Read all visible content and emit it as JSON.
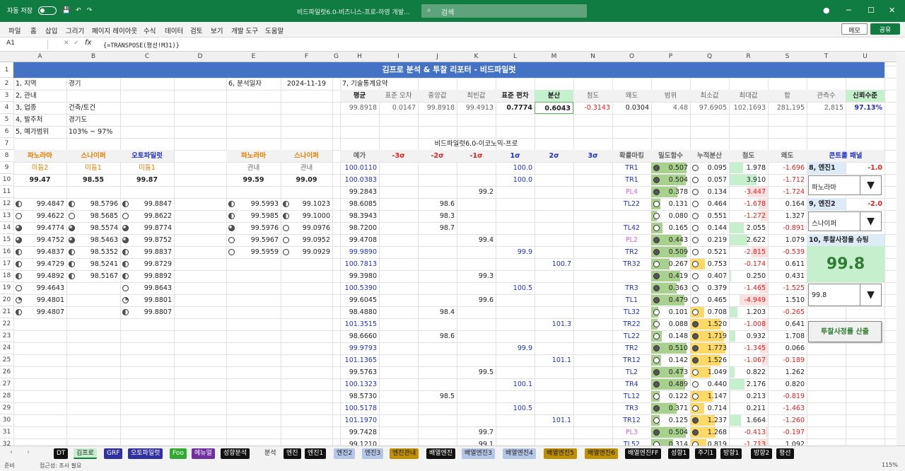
{
  "titlebar": {
    "autosave": "자동 저장",
    "file": "비드파일럿6.0-비즈니스-프로-하영 개발...",
    "search": "검색",
    "min": "─",
    "max": "☐",
    "close": "✕"
  },
  "menu": [
    "파일",
    "홈",
    "삽입",
    "그리기",
    "페이지 레이아웃",
    "수식",
    "데이터",
    "검토",
    "보기",
    "개발 도구",
    "도움말"
  ],
  "memo": "메모",
  "share": "공유",
  "namebox": "A1",
  "formula": "{=TRANSPOSE(평선!M31)}",
  "columns": [
    "A",
    "B",
    "C",
    "D",
    "E",
    "F",
    "G",
    "H",
    "I",
    "J",
    "K",
    "L",
    "M",
    "N",
    "O",
    "P",
    "Q",
    "R",
    "S",
    "T",
    "U"
  ],
  "rows": [
    "1",
    "2",
    "3",
    "4",
    "5",
    "6",
    "7",
    "8",
    "9",
    "10",
    "11",
    "12",
    "13",
    "14",
    "15",
    "16",
    "17",
    "18",
    "19",
    "20",
    "21",
    "22",
    "23",
    "24",
    "25",
    "26",
    "27",
    "28",
    "29",
    "30",
    "31",
    "32",
    "33"
  ],
  "banner": "김프로 분석 & 투찰 리포터 - 비드파일럿",
  "info": {
    "l1": "1, 지역",
    "v1": "경기",
    "l2": "2, 관내",
    "v2": "",
    "l3": "3, 업종",
    "v3": "건축/토건",
    "l4": "4, 발주처",
    "v4": "경기도",
    "l5": "5, 예가범위",
    "v5": "103% ~ 97%",
    "l6": "6, 분석일자",
    "v6": "2024-11-19",
    "l7": "7, 기술통계요약"
  },
  "stats": {
    "headers": [
      "평균",
      "표준 오차",
      "중앙값",
      "최빈값",
      "표준 편차",
      "분산",
      "첨도",
      "왜도",
      "범위",
      "최소값",
      "최대값",
      "합",
      "관측수",
      "신뢰수준"
    ],
    "values": [
      "99.8918",
      "0.0147",
      "99.8918",
      "99.4913",
      "0.7774",
      "0.6043",
      "-0.3143",
      "0.0304",
      "4.48",
      "97.6905",
      "102.1693",
      "281,195",
      "2,815",
      "97.13%"
    ]
  },
  "subtitle": "비드파일럿6.0-이코노믹-프로",
  "left": {
    "h1": "파노라마",
    "h2": "스나이퍼",
    "h3": "오토파일럿",
    "s1": "미듐2",
    "s2": "미듐1",
    "s3": "미듐1",
    "t1": "99.47",
    "t2": "98.55",
    "t3": "99.87",
    "e1": "파노라마",
    "e2": "스나이퍼",
    "es1": "관내",
    "es2": "관내",
    "et1": "99.59",
    "et2": "99.09"
  },
  "colA": [
    "99.4847",
    "99.4622",
    "99.4774",
    "99.4752",
    "99.4837",
    "99.4729",
    "99.4892",
    "99.4643",
    "99.4801",
    "99.4807"
  ],
  "colB": [
    "98.5796",
    "98.5685",
    "98.5574",
    "98.5463",
    "98.5352",
    "98.5241",
    "98.5167",
    "",
    "",
    ""
  ],
  "colC": [
    "99.8847",
    "99.8622",
    "99.8774",
    "99.8752",
    "99.8837",
    "99.8729",
    "99.8892",
    "99.8643",
    "99.8801",
    "99.8807"
  ],
  "colE": [
    "99.5993",
    "99.5985",
    "99.5976",
    "99.5967",
    "99.5959"
  ],
  "colF": [
    "99.1023",
    "99.1000",
    "99.0976",
    "99.0952",
    "99.0929"
  ],
  "right": {
    "hdr": [
      "예가",
      "-3σ",
      "-2σ",
      "-1σ",
      "1σ",
      "2σ",
      "3σ",
      "확률마킹",
      "밀도함수",
      "누적분산",
      "첨도",
      "왜도"
    ],
    "rows": [
      [
        "100.0110",
        "",
        "",
        "",
        "100.0",
        "",
        "",
        "TR1",
        "0.507",
        "0.095",
        "1.978",
        "-1.696"
      ],
      [
        "100.0383",
        "",
        "",
        "",
        "100.0",
        "",
        "",
        "TR1",
        "0.504",
        "0.057",
        "3.910",
        "-1.712"
      ],
      [
        "99.2843",
        "",
        "",
        "99.2",
        "",
        "",
        "",
        "PL4",
        "0.378",
        "0.134",
        "-3.447",
        "-1.724"
      ],
      [
        "98.6085",
        "",
        "98.6",
        "",
        "",
        "",
        "",
        "TL22",
        "0.131",
        "0.464",
        "-1.678",
        "0.164"
      ],
      [
        "98.3943",
        "",
        "98.3",
        "",
        "",
        "",
        "",
        "",
        "0.080",
        "0.551",
        "-1.272",
        "1.327"
      ],
      [
        "98.7200",
        "",
        "98.7",
        "",
        "",
        "",
        "",
        "TL42",
        "0.165",
        "0.144",
        "2.055",
        "-0.891"
      ],
      [
        "99.4708",
        "",
        "",
        "99.4",
        "",
        "",
        "",
        "PL2",
        "0.443",
        "0.219",
        "2.622",
        "1.079"
      ],
      [
        "99.9890",
        "",
        "",
        "",
        "99.9",
        "",
        "",
        "TR2",
        "0.509",
        "0.521",
        "-2.815",
        "-0.539"
      ],
      [
        "100.7813",
        "",
        "",
        "",
        "",
        "100.7",
        "",
        "TR32",
        "0.267",
        "0.753",
        "-0.174",
        "0.611"
      ],
      [
        "99.3980",
        "",
        "",
        "99.3",
        "",
        "",
        "",
        "",
        "0.419",
        "0.407",
        "0.250",
        "0.431"
      ],
      [
        "100.5390",
        "",
        "",
        "",
        "100.5",
        "",
        "",
        "TR3",
        "0.363",
        "0.379",
        "-1.465",
        "-1.525"
      ],
      [
        "99.6045",
        "",
        "",
        "99.6",
        "",
        "",
        "",
        "TL1",
        "0.479",
        "0.465",
        "-4.949",
        "1.510"
      ],
      [
        "98.4880",
        "",
        "98.4",
        "",
        "",
        "",
        "",
        "TL32",
        "0.101",
        "0.708",
        "1.203",
        "-0.265"
      ],
      [
        "101.3515",
        "",
        "",
        "",
        "",
        "101.3",
        "",
        "TR22",
        "0.088",
        "1.520",
        "-1.008",
        "0.641"
      ],
      [
        "98.6660",
        "",
        "98.6",
        "",
        "",
        "",
        "",
        "TL22",
        "0.148",
        "1.719",
        "0.932",
        "1.708"
      ],
      [
        "99.9793",
        "",
        "",
        "",
        "99.9",
        "",
        "",
        "TR2",
        "0.510",
        "1.773",
        "-1.345",
        "0.066"
      ],
      [
        "101.1365",
        "",
        "",
        "",
        "",
        "101.1",
        "",
        "TR12",
        "0.142",
        "1.526",
        "-1.067",
        "-0.189"
      ],
      [
        "99.5763",
        "",
        "",
        "99.5",
        "",
        "",
        "",
        "TL2",
        "0.473",
        "1.049",
        "0.822",
        "1.262"
      ],
      [
        "100.1323",
        "",
        "",
        "",
        "100.1",
        "",
        "",
        "TR4",
        "0.489",
        "0.440",
        "2.176",
        "0.820"
      ],
      [
        "98.5730",
        "",
        "98.5",
        "",
        "",
        "",
        "",
        "TL12",
        "0.122",
        "1.147",
        "0.213",
        "-0.819"
      ],
      [
        "100.5178",
        "",
        "",
        "",
        "100.5",
        "",
        "",
        "TR3",
        "0.371",
        "0.714",
        "0.211",
        "-1.463"
      ],
      [
        "101.1970",
        "",
        "",
        "",
        "",
        "101.1",
        "",
        "TR12",
        "0.125",
        "1.237",
        "1.664",
        "-1.260"
      ],
      [
        "99.7428",
        "",
        "",
        "99.7",
        "",
        "",
        "",
        "PL3",
        "0.504",
        "1.268",
        "-0.413",
        "-0.197"
      ],
      [
        "99.1210",
        "",
        "",
        "99.1",
        "",
        "",
        "",
        "TL52",
        "0.314",
        "0.819",
        "-1.713",
        "1.092"
      ]
    ]
  },
  "control": {
    "title": "콘트롤 패널",
    "e1": "8, 엔진1",
    "e1v": "-1.0",
    "d1": "파노라마",
    "e2": "9, 엔진2",
    "e2v": "-2.0",
    "d2": "스나이퍼",
    "shoot": "10, 투찰사정율 슈팅",
    "big": "99.8",
    "d3": "99.8",
    "btn": "투찰사정률 산출"
  },
  "tabs": [
    "DT",
    "김프로",
    "GRF",
    "오토파일럿",
    "Foo",
    "메뉴얼",
    "성향분석",
    "분석",
    "엔진",
    "엔진1",
    "엔진2",
    "엔진3",
    "엔진관내",
    "배열엔진",
    "배열엔진3",
    "배열엔진4",
    "배열엔진5",
    "배열엔진6",
    "배열엔진FF",
    "성향1",
    "주기1",
    "방향1",
    "방향2",
    "평선"
  ],
  "status": {
    "ready": "준비",
    "access": "접근성: 조사 필요",
    "zoom": "115%"
  }
}
